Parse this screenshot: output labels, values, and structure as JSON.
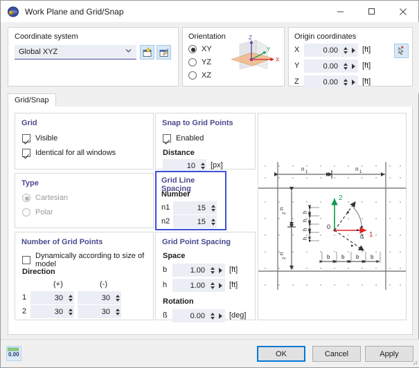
{
  "window": {
    "title": "Work Plane and Grid/Snap",
    "icon": "work-plane-icon",
    "minimize": "—",
    "maximize": "□",
    "close": "✕"
  },
  "coordinate_system": {
    "title": "Coordinate system",
    "value": "Global XYZ",
    "new_button": "new-coordinate-system-icon",
    "edit_button": "edit-coordinate-system-icon"
  },
  "orientation": {
    "title": "Orientation",
    "options": [
      {
        "label": "XY",
        "selected": true
      },
      {
        "label": "YZ",
        "selected": false
      },
      {
        "label": "XZ",
        "selected": false
      }
    ],
    "preview_axes": [
      "Z",
      "Y",
      "X"
    ]
  },
  "origin": {
    "title": "Origin coordinates",
    "pick_button": "pick-point-icon",
    "rows": [
      {
        "label": "X",
        "value": "0.00",
        "unit": "[ft]"
      },
      {
        "label": "Y",
        "value": "0.00",
        "unit": "[ft]"
      },
      {
        "label": "Z",
        "value": "0.00",
        "unit": "[ft]"
      }
    ]
  },
  "tab": {
    "label": "Grid/Snap"
  },
  "grid": {
    "title": "Grid",
    "visible": {
      "label": "Visible",
      "checked": true
    },
    "identical": {
      "label": "Identical for all windows",
      "checked": true
    }
  },
  "snap": {
    "title": "Snap to Grid Points",
    "enabled": {
      "label": "Enabled",
      "checked": true
    },
    "distance_label": "Distance",
    "distance_value": "10",
    "distance_unit": "[px]"
  },
  "type": {
    "title": "Type",
    "options": [
      {
        "label": "Cartesian",
        "selected": true,
        "disabled": true
      },
      {
        "label": "Polar",
        "selected": false,
        "disabled": true
      }
    ]
  },
  "grid_line_spacing": {
    "title": "Grid Line Spacing",
    "subhead": "Number",
    "highlight_color": "#3b4fd8",
    "rows": [
      {
        "label": "n1",
        "value": "15"
      },
      {
        "label": "n2",
        "value": "15"
      }
    ]
  },
  "number_of_grid_points": {
    "title": "Number of Grid Points",
    "dynamic": {
      "label": "Dynamically according to size of model",
      "checked": false
    },
    "direction_label": "Direction",
    "col_plus": "(+)",
    "col_minus": "(-)",
    "rows": [
      {
        "label": "1",
        "plus": "30",
        "minus": "30"
      },
      {
        "label": "2",
        "plus": "30",
        "minus": "30"
      }
    ]
  },
  "grid_point_spacing": {
    "title": "Grid Point Spacing",
    "space_label": "Space",
    "space_rows": [
      {
        "label": "b",
        "value": "1.00",
        "unit": "[ft]"
      },
      {
        "label": "h",
        "value": "1.00",
        "unit": "[ft]"
      }
    ],
    "rotation_label": "Rotation",
    "rotation_row": {
      "label": "ß",
      "value": "0.00",
      "unit": "[deg]"
    }
  },
  "diagram": {
    "name": "grid-snap-diagram",
    "labels": {
      "n1": "n₁",
      "n2": "n₂",
      "h": "h",
      "b": "b",
      "beta": "β",
      "origin": "0",
      "axis1": "1",
      "axis2": "2"
    }
  },
  "footer": {
    "units_button": "units-settings-icon",
    "ok": "OK",
    "cancel": "Cancel",
    "apply": "Apply"
  }
}
